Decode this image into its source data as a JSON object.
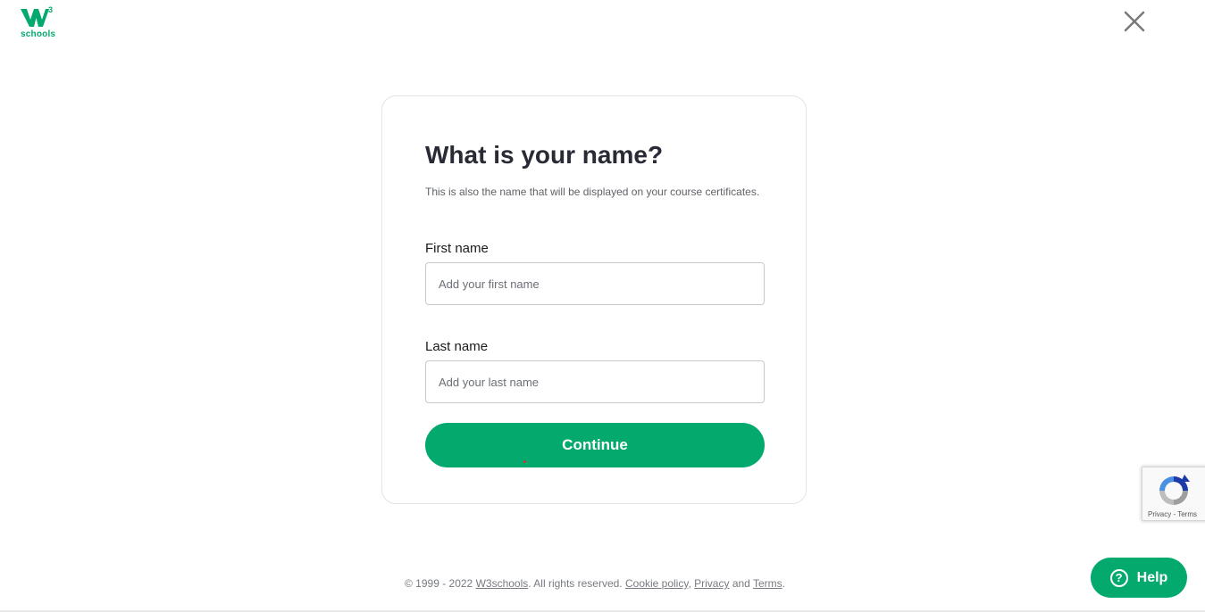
{
  "brand": {
    "logo_text": "W3",
    "wordmark": "schools",
    "color": "#04aa6d"
  },
  "header": {
    "close_icon": "close-icon"
  },
  "form": {
    "title": "What is your name?",
    "subtitle": "This is also the name that will be displayed on your course certificates.",
    "first_name": {
      "label": "First name",
      "placeholder": "Add your first name",
      "value": ""
    },
    "last_name": {
      "label": "Last name",
      "placeholder": "Add your last name",
      "value": ""
    },
    "submit_label": "Continue"
  },
  "footer": {
    "prefix": "© 1999 - 2022 ",
    "site_link": "W3schools",
    "rights": ". All rights reserved. ",
    "cookie_link": "Cookie policy",
    "sep": ", ",
    "privacy_link": "Privacy",
    "and": " and ",
    "terms_link": "Terms",
    "end": "."
  },
  "recaptcha": {
    "privacy": "Privacy",
    "dot": " - ",
    "terms": "Terms"
  },
  "help": {
    "icon": "question-circle-icon",
    "label": "Help"
  },
  "colors": {
    "accent": "#04aa6d",
    "text": "#282a35",
    "muted": "#777b80"
  }
}
